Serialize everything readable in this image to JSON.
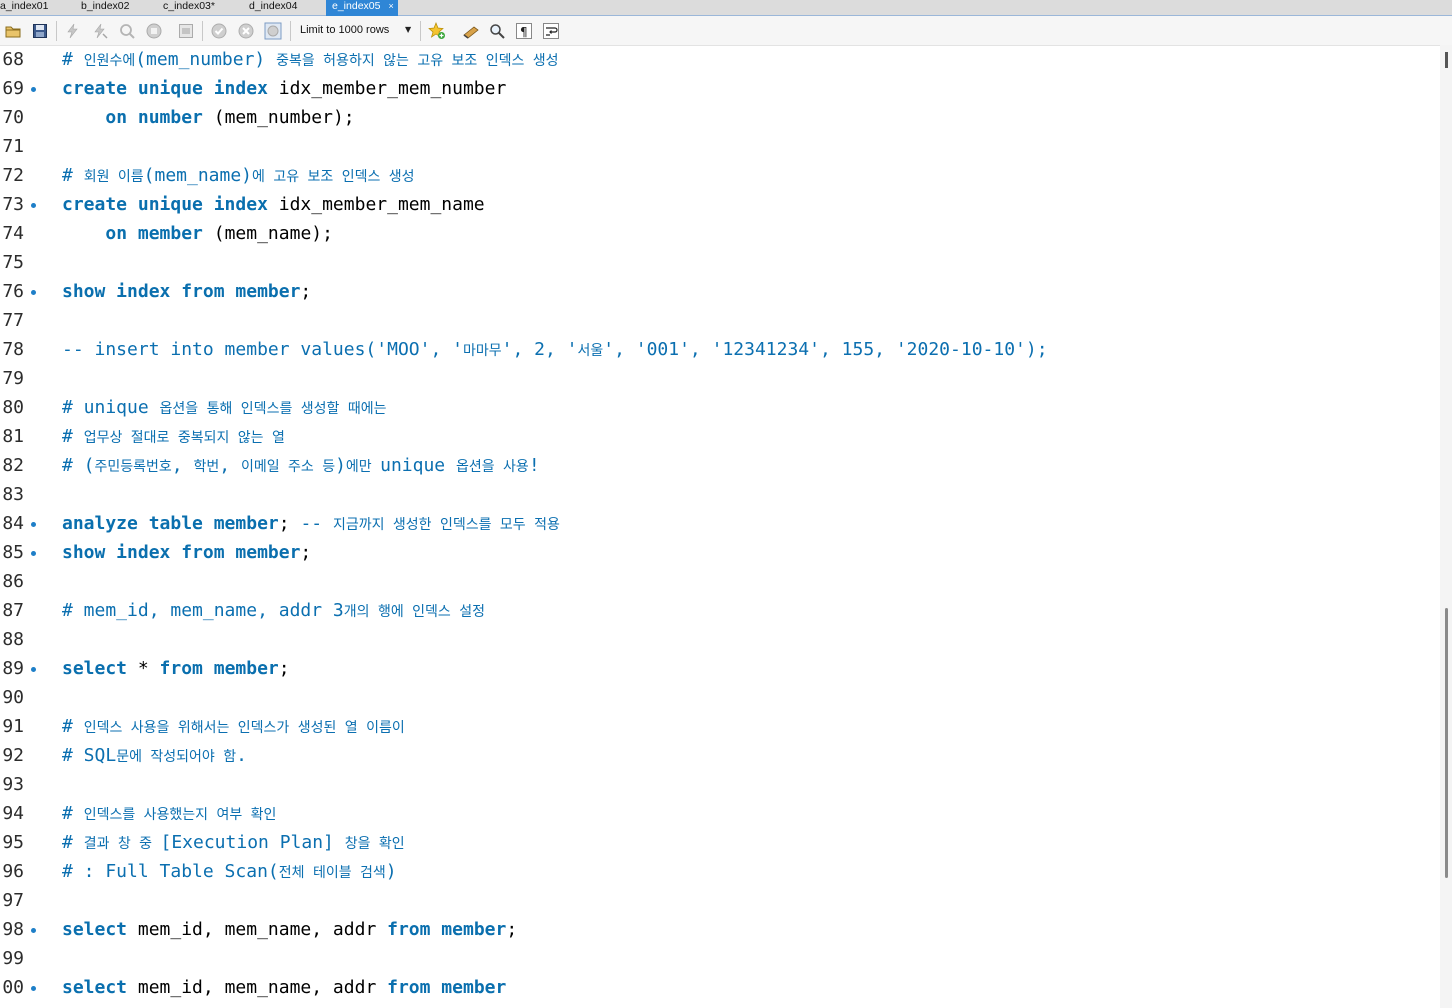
{
  "tabs": [
    {
      "label": "a_index01",
      "active": false
    },
    {
      "label": "b_index02",
      "active": false
    },
    {
      "label": "c_index03*",
      "active": false
    },
    {
      "label": "d_index04",
      "active": false
    },
    {
      "label": "e_index05",
      "active": true,
      "close": "×"
    }
  ],
  "toolbar": {
    "icons": [
      "open-file-icon",
      "save-icon",
      "execute-icon",
      "execute-current-icon",
      "explain-icon",
      "stop-icon",
      "toggle-result-icon",
      "commit-icon",
      "rollback-icon",
      "autocommit-icon",
      "beautify-icon",
      "find-icon",
      "invisible-chars-icon",
      "wrap-lines-icon"
    ],
    "limit_label": "Limit to 1000 rows"
  },
  "colors": {
    "keyword": "#0a6fae",
    "comment": "#0b6fb0",
    "active_tab": "#2f86d6"
  },
  "editor": {
    "lines": [
      {
        "n": "68",
        "dot": false,
        "segments": [
          {
            "t": "# ",
            "c": "cm"
          },
          {
            "t": "인원수에",
            "c": "cm cm-ko"
          },
          {
            "t": "(mem_number) ",
            "c": "cm"
          },
          {
            "t": "중복을 허용하지 않는 고유 보조 인덱스 생성",
            "c": "cm cm-ko"
          }
        ]
      },
      {
        "n": "69",
        "dot": true,
        "segments": [
          {
            "t": "create unique index",
            "c": "kw"
          },
          {
            "t": " idx_member_mem_number",
            "c": ""
          }
        ]
      },
      {
        "n": "70",
        "dot": false,
        "segments": [
          {
            "t": "    ",
            "c": ""
          },
          {
            "t": "on number",
            "c": "kw"
          },
          {
            "t": " (mem_number);",
            "c": ""
          }
        ]
      },
      {
        "n": "71",
        "dot": false,
        "segments": []
      },
      {
        "n": "72",
        "dot": false,
        "segments": [
          {
            "t": "# ",
            "c": "cm"
          },
          {
            "t": "회원 이름",
            "c": "cm cm-ko"
          },
          {
            "t": "(mem_name)",
            "c": "cm"
          },
          {
            "t": "에 고유 보조 인덱스 생성",
            "c": "cm cm-ko"
          }
        ]
      },
      {
        "n": "73",
        "dot": true,
        "segments": [
          {
            "t": "create unique index",
            "c": "kw"
          },
          {
            "t": " idx_member_mem_name",
            "c": ""
          }
        ]
      },
      {
        "n": "74",
        "dot": false,
        "segments": [
          {
            "t": "    ",
            "c": ""
          },
          {
            "t": "on member",
            "c": "kw"
          },
          {
            "t": " (mem_name);",
            "c": ""
          }
        ]
      },
      {
        "n": "75",
        "dot": false,
        "segments": []
      },
      {
        "n": "76",
        "dot": true,
        "segments": [
          {
            "t": "show index from member",
            "c": "kw"
          },
          {
            "t": ";",
            "c": ""
          }
        ]
      },
      {
        "n": "77",
        "dot": false,
        "segments": []
      },
      {
        "n": "78",
        "dot": false,
        "segments": [
          {
            "t": "-- insert into member values('MOO', '",
            "c": "cm"
          },
          {
            "t": "마마무",
            "c": "cm cm-ko"
          },
          {
            "t": "', 2, '",
            "c": "cm"
          },
          {
            "t": "서울",
            "c": "cm cm-ko"
          },
          {
            "t": "', '001', '12341234', 155, '2020-10-10');",
            "c": "cm"
          }
        ]
      },
      {
        "n": "79",
        "dot": false,
        "segments": []
      },
      {
        "n": "80",
        "dot": false,
        "segments": [
          {
            "t": "# unique ",
            "c": "cm"
          },
          {
            "t": "옵션을 통해 인덱스를 생성할 때에는",
            "c": "cm cm-ko"
          }
        ]
      },
      {
        "n": "81",
        "dot": false,
        "segments": [
          {
            "t": "# ",
            "c": "cm"
          },
          {
            "t": "업무상 절대로 중복되지 않는 열",
            "c": "cm cm-ko"
          }
        ]
      },
      {
        "n": "82",
        "dot": false,
        "segments": [
          {
            "t": "# (",
            "c": "cm"
          },
          {
            "t": "주민등록번호",
            "c": "cm cm-ko"
          },
          {
            "t": ", ",
            "c": "cm"
          },
          {
            "t": "학번",
            "c": "cm cm-ko"
          },
          {
            "t": ", ",
            "c": "cm"
          },
          {
            "t": "이메일 주소 등",
            "c": "cm cm-ko"
          },
          {
            "t": ")",
            "c": "cm"
          },
          {
            "t": "에만 ",
            "c": "cm cm-ko"
          },
          {
            "t": "unique ",
            "c": "cm"
          },
          {
            "t": "옵션을 사용",
            "c": "cm cm-ko"
          },
          {
            "t": "!",
            "c": "cm"
          }
        ]
      },
      {
        "n": "83",
        "dot": false,
        "segments": []
      },
      {
        "n": "84",
        "dot": true,
        "segments": [
          {
            "t": "analyze table member",
            "c": "kw"
          },
          {
            "t": "; ",
            "c": ""
          },
          {
            "t": "-- ",
            "c": "cm"
          },
          {
            "t": "지금까지 생성한 인덱스를 모두 적용",
            "c": "cm cm-ko"
          }
        ]
      },
      {
        "n": "85",
        "dot": true,
        "segments": [
          {
            "t": "show index from member",
            "c": "kw"
          },
          {
            "t": ";",
            "c": ""
          }
        ]
      },
      {
        "n": "86",
        "dot": false,
        "segments": []
      },
      {
        "n": "87",
        "dot": false,
        "segments": [
          {
            "t": "# mem_id, mem_name, addr 3",
            "c": "cm"
          },
          {
            "t": "개의 행에 인덱스 설정",
            "c": "cm cm-ko"
          }
        ]
      },
      {
        "n": "88",
        "dot": false,
        "segments": []
      },
      {
        "n": "89",
        "dot": true,
        "segments": [
          {
            "t": "select",
            "c": "kw"
          },
          {
            "t": " * ",
            "c": ""
          },
          {
            "t": "from member",
            "c": "kw"
          },
          {
            "t": ";",
            "c": ""
          }
        ]
      },
      {
        "n": "90",
        "dot": false,
        "segments": []
      },
      {
        "n": "91",
        "dot": false,
        "segments": [
          {
            "t": "# ",
            "c": "cm"
          },
          {
            "t": "인덱스 사용을 위해서는 인덱스가 생성된 열 이름이",
            "c": "cm cm-ko"
          }
        ]
      },
      {
        "n": "92",
        "dot": false,
        "segments": [
          {
            "t": "# SQL",
            "c": "cm"
          },
          {
            "t": "문에 작성되어야 함",
            "c": "cm cm-ko"
          },
          {
            "t": ".",
            "c": "cm"
          }
        ]
      },
      {
        "n": "93",
        "dot": false,
        "segments": []
      },
      {
        "n": "94",
        "dot": false,
        "segments": [
          {
            "t": "# ",
            "c": "cm"
          },
          {
            "t": "인덱스를 사용했는지 여부 확인",
            "c": "cm cm-ko"
          }
        ]
      },
      {
        "n": "95",
        "dot": false,
        "segments": [
          {
            "t": "# ",
            "c": "cm"
          },
          {
            "t": "결과 창 중 ",
            "c": "cm cm-ko"
          },
          {
            "t": "[Execution Plan] ",
            "c": "cm"
          },
          {
            "t": "창을 확인",
            "c": "cm cm-ko"
          }
        ]
      },
      {
        "n": "96",
        "dot": false,
        "segments": [
          {
            "t": "# : Full Table Scan(",
            "c": "cm"
          },
          {
            "t": "전체 테이블 검색",
            "c": "cm cm-ko"
          },
          {
            "t": ")",
            "c": "cm"
          }
        ]
      },
      {
        "n": "97",
        "dot": false,
        "segments": []
      },
      {
        "n": "98",
        "dot": true,
        "segments": [
          {
            "t": "select",
            "c": "kw"
          },
          {
            "t": " mem_id, mem_name, addr ",
            "c": ""
          },
          {
            "t": "from member",
            "c": "kw"
          },
          {
            "t": ";",
            "c": ""
          }
        ]
      },
      {
        "n": "99",
        "dot": false,
        "segments": []
      },
      {
        "n": "00",
        "dot": true,
        "segments": [
          {
            "t": "select",
            "c": "kw"
          },
          {
            "t": " mem_id, mem_name, addr ",
            "c": ""
          },
          {
            "t": "from member",
            "c": "kw"
          }
        ]
      }
    ]
  }
}
